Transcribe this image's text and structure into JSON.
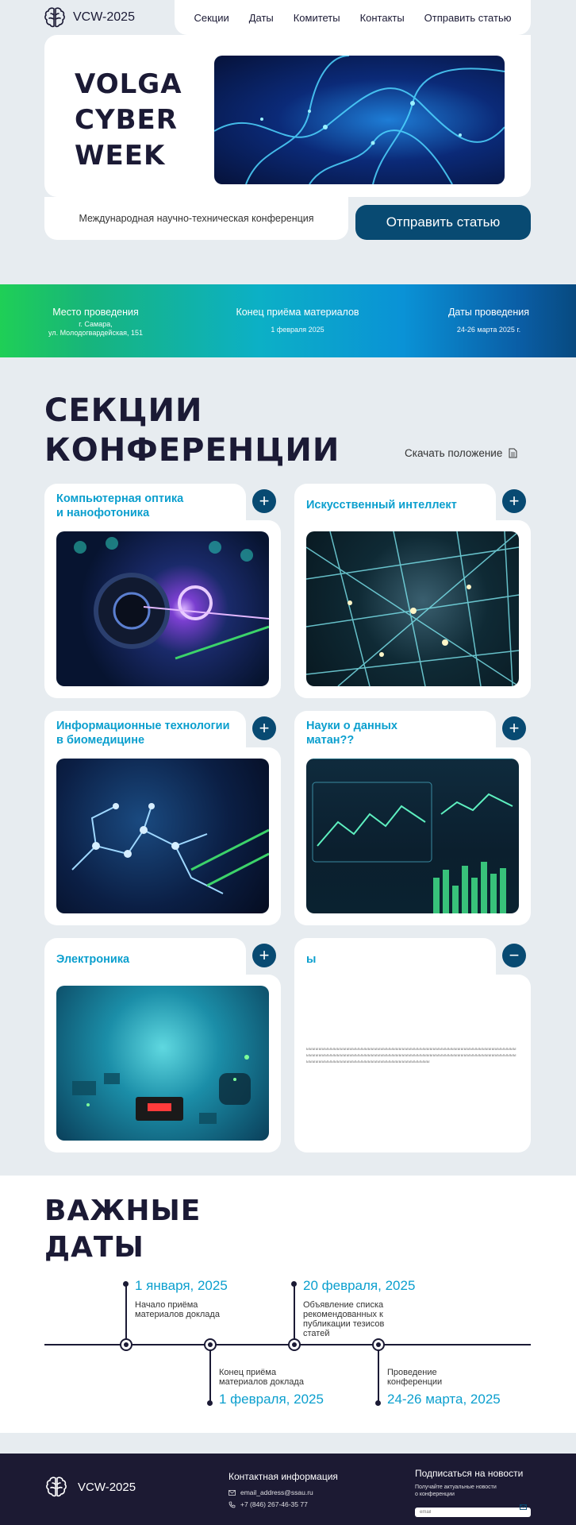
{
  "header": {
    "logo_text": "VCW-2025",
    "nav": [
      "Секции",
      "Даты",
      "Комитеты",
      "Контакты",
      "Отправить статью"
    ]
  },
  "hero": {
    "title": "VOLGA\nCYBER\nWEEK",
    "subtitle": "Международная научно-техническая конференция",
    "cta": "Отправить статью"
  },
  "info": {
    "venue_label": "Место проведения",
    "venue_value": "г. Самара,\nул. Молодогвардейская, 151",
    "deadline_label": "Конец приёма материалов",
    "deadline_value": "1 февраля 2025",
    "dates_label": "Даты проведения",
    "dates_value": "24-26 марта 2025 г."
  },
  "sections": {
    "title": "СЕКЦИИ\nКОНФЕРЕНЦИИ",
    "download": "Скачать положение",
    "cards": [
      {
        "title": "Компьютерная оптика\nи нанофотоника",
        "toggle": "+"
      },
      {
        "title": "Искусственный интеллект",
        "toggle": "+"
      },
      {
        "title": "Информационные технологии\nв биомедицине",
        "toggle": "+"
      },
      {
        "title": "Науки о данных\nматан??",
        "toggle": "+"
      },
      {
        "title": "Электроника",
        "toggle": "+"
      },
      {
        "title": "ы",
        "toggle": "−",
        "text": "ыыыыыыыыыыыыыыыыыыыыыыыыыыыыыыыыыыыыыыыыыыыыыыыыыыыыыыыыыыыыыыыыыыыыыыыыыыыыыыыыыыыыыыыыыыыыыыыыыыыыыыыыыыыыыыыыыыыыыыыыыыыыыыыыыыыыыыыыыыыыыыыыыыыыыыыыыыыыыыыыыыыыыыыыыыыыыыыы"
      }
    ]
  },
  "dates": {
    "title": "ВАЖНЫЕ\nДАТЫ",
    "items": [
      {
        "date": "1 января, 2025",
        "desc": "Начало приёма\nматериалов доклада"
      },
      {
        "date": "1 февраля, 2025",
        "desc": "Конец приёма\nматериалов доклада"
      },
      {
        "date": "20 февраля, 2025",
        "desc": "Объявление списка\nрекомендованных к\nпубликации тезисов\nстатей"
      },
      {
        "date": "24-26 марта, 2025",
        "desc": "Проведение\nконференции"
      }
    ]
  },
  "footer": {
    "logo_text": "VCW-2025",
    "contact_title": "Контактная информация",
    "email": "email_address@ssau.ru",
    "phone": "+7 (846) 267-46-35 77",
    "subscribe_title": "Подписаться на новости",
    "subscribe_text": "Получайте актуальные новости\nо конференции",
    "email_placeholder": "email"
  },
  "colors": {
    "accent": "#084a72",
    "title_blue": "#0b9fce",
    "dark": "#1b1a35"
  }
}
